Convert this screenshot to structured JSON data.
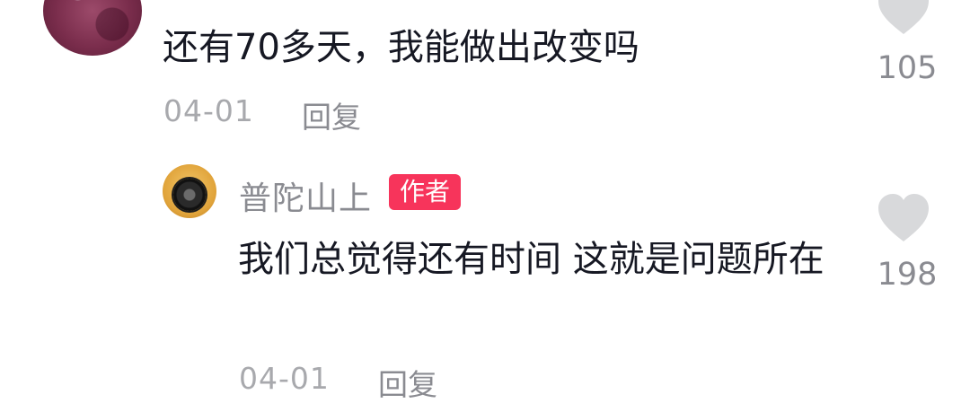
{
  "comments": [
    {
      "username": "",
      "text": "还有70多天，我能做出改变吗",
      "date": "04-01",
      "reply_label": "回复",
      "likes": "105",
      "avatar_icon": "avatar-dark-red-circle"
    },
    {
      "username": "普陀山上",
      "badge": "作者",
      "text": "我们总觉得还有时间 这就是问题所在",
      "date": "04-01",
      "reply_label": "回复",
      "likes": "198",
      "avatar_icon": "avatar-orange-with-black-disk"
    }
  ],
  "icons": {
    "like": "heart-icon"
  },
  "colors": {
    "badge_bg": "#f7345b",
    "muted_text": "#8a8b91",
    "heart": "#d8d9db"
  }
}
